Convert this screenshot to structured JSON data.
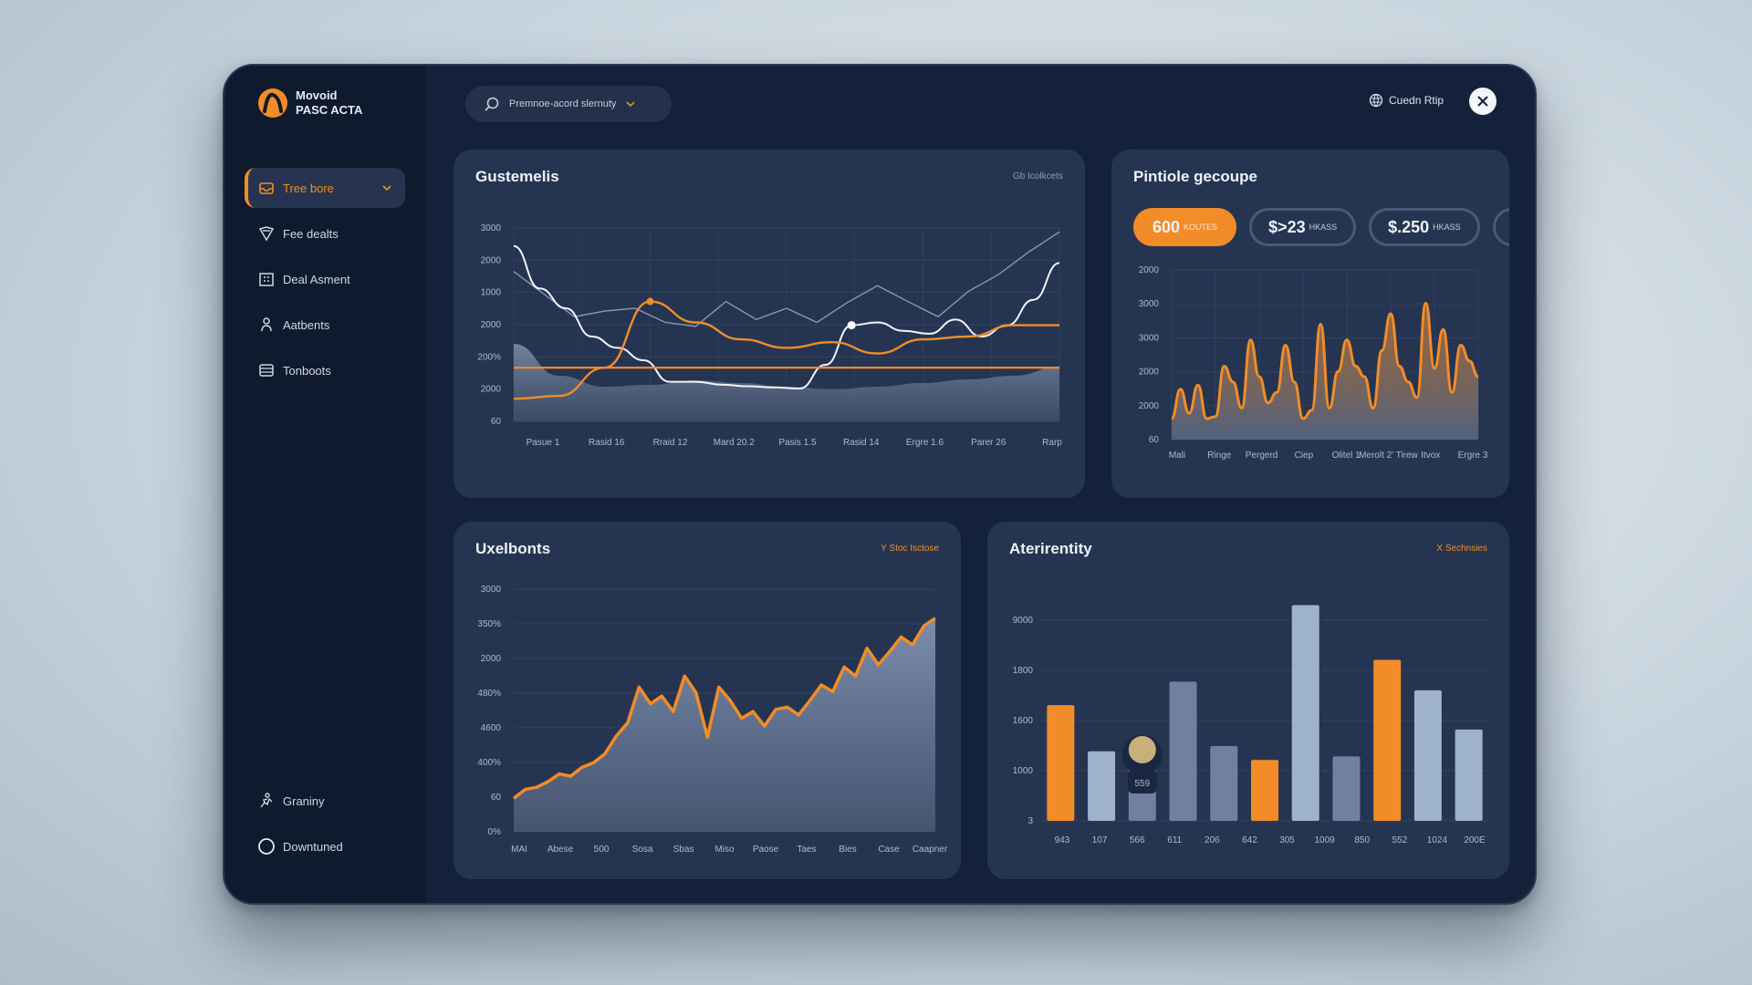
{
  "brand": {
    "line1": "Movoid",
    "line2": "PASC ACTA"
  },
  "sidebar": {
    "items": [
      {
        "label": "Tree bore",
        "icon": "inbox-icon",
        "active": true
      },
      {
        "label": "Fee dealts",
        "icon": "shield-icon"
      },
      {
        "label": "Deal Asment",
        "icon": "building-icon"
      },
      {
        "label": "Aatbents",
        "icon": "user-icon"
      },
      {
        "label": "Tonboots",
        "icon": "stack-icon"
      }
    ],
    "bottom": [
      {
        "label": "Graniny",
        "icon": "person-run-icon"
      },
      {
        "label": "Downtuned",
        "icon": "circle-icon"
      }
    ]
  },
  "topbar": {
    "search_label": "Premnoe-acord slernuty",
    "account_label": "Cuedn Rtip"
  },
  "colors": {
    "accent": "#f28c28",
    "panel": "#253551",
    "sidebar": "#0f1a2f",
    "light_bar": "#9fb2cc",
    "mid_bar": "#6f819e"
  },
  "panels": {
    "customers": {
      "title": "Gustemelis",
      "link": "Gb Icolkcets"
    },
    "profile": {
      "title": "Pintiole gecoupe",
      "pills": [
        {
          "value": "600",
          "unit": "KOUTES",
          "active": true
        },
        {
          "value": "$>23",
          "unit": "HKASS",
          "active": false
        },
        {
          "value": "$.250",
          "unit": "HKASS",
          "active": false
        },
        {
          "value": "$",
          "unit": "",
          "active": false
        }
      ]
    },
    "uxelbonts": {
      "title": "Uxelbonts",
      "link": "Y Stoc Isctose"
    },
    "activity": {
      "title": "Aterirentity",
      "link": "X Sechnsies",
      "marker_label": "559"
    }
  },
  "chart_data": [
    {
      "type": "line",
      "categories": [
        "Pasue 1",
        "Rasid 16",
        "Rraid 12",
        "Mard 20.2",
        "Pasis 1.5",
        "Rasid 14",
        "Ergre 1.6",
        "Parer 26",
        "Rarp"
      ],
      "y_ticks": [
        "3000",
        "2000",
        "1000",
        "2000",
        "200%",
        "2000",
        "60"
      ],
      "series": [
        {
          "values": [
            85,
            50,
            38,
            40,
            45,
            42,
            38,
            35,
            38,
            42,
            46,
            50,
            60
          ],
          "style": "area"
        },
        {
          "values": [
            265,
            225,
            185,
            195,
            200,
            175,
            168,
            212,
            180,
            200,
            175,
            210,
            240,
            212,
            185,
            230,
            260,
            300,
            335
          ]
        },
        {
          "values": [
            310,
            235,
            200,
            150,
            130,
            108,
            70,
            70,
            65,
            62,
            60,
            58,
            100,
            170,
            175,
            160,
            155,
            180,
            150,
            170,
            215,
            280
          ]
        },
        {
          "values": [
            40,
            45,
            95,
            212,
            175,
            145,
            130,
            140,
            120,
            145,
            150,
            170,
            170
          ]
        },
        {
          "values": [
            95,
            95,
            95,
            95,
            95,
            95,
            95,
            95,
            95,
            95,
            95,
            95,
            95
          ]
        }
      ]
    },
    {
      "type": "area",
      "categories": [
        "Mali",
        "Ringe",
        "Pergerd",
        "Ciep",
        "Olitel 1",
        "Merolt 2' Tirew",
        "Itvox",
        "Ergre 3"
      ],
      "y_ticks": [
        "2000",
        "3000",
        "3000",
        "2000",
        "2000",
        "60"
      ],
      "values": [
        20,
        48,
        25,
        52,
        20,
        22,
        70,
        55,
        30,
        95,
        60,
        35,
        45,
        90,
        55,
        20,
        28,
        110,
        30,
        65,
        95,
        70,
        60,
        30,
        85,
        120,
        70,
        55,
        40,
        130,
        68,
        105,
        45,
        90,
        75,
        60
      ]
    },
    {
      "type": "area",
      "categories": [
        "MAI",
        "Abese",
        "500",
        "Sosa",
        "Sbas",
        "Miso",
        "Paose",
        "Taes",
        "Bies",
        "Case",
        "Caapner"
      ],
      "y_ticks": [
        "3000",
        "350%",
        "2000",
        "480%",
        "4600",
        "400%",
        "60",
        "0%"
      ],
      "values": [
        30,
        38,
        40,
        45,
        52,
        50,
        58,
        62,
        70,
        86,
        98,
        130,
        115,
        122,
        108,
        140,
        125,
        85,
        130,
        118,
        102,
        108,
        95,
        110,
        112,
        105,
        118,
        132,
        126,
        148,
        140,
        165,
        150,
        162,
        175,
        168,
        185,
        192
      ]
    },
    {
      "type": "bar",
      "categories": [
        "943",
        "107",
        "566",
        "611",
        "206",
        "642",
        "305",
        "1009",
        "850",
        "552",
        "1024",
        "200E"
      ],
      "y_ticks": [
        "9000",
        "1800",
        "1600",
        "1000",
        "3"
      ],
      "values": [
        1330,
        800,
        890,
        1600,
        860,
        700,
        2480,
        740,
        1850,
        1500,
        1050
      ],
      "bar_colors": [
        "orange",
        "light",
        "mid",
        "mid",
        "mid",
        "orange",
        "light",
        "mid",
        "orange",
        "light",
        "light"
      ]
    }
  ]
}
